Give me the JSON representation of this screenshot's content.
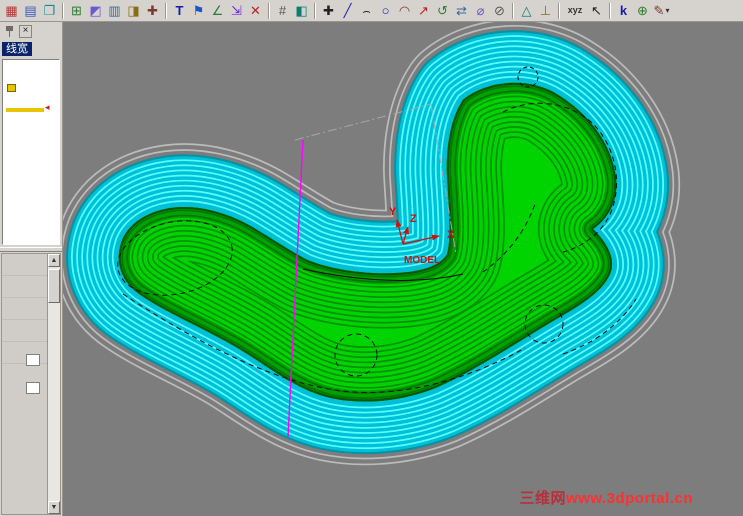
{
  "window": {
    "toolbar_bg": "#d6d3ce",
    "viewport_bg": "#7d7d7d"
  },
  "toolbar": {
    "flyout_arrow": "▾",
    "icons": [
      {
        "name": "sheet-grid-icon",
        "glyph": "▦",
        "color": "#b23333"
      },
      {
        "name": "workbook-icon",
        "glyph": "▤",
        "color": "#3355bb"
      },
      {
        "name": "cascade-windows-icon",
        "glyph": "❐",
        "color": "#118a9e"
      },
      {
        "type": "sep"
      },
      {
        "name": "grid-view-icon",
        "glyph": "⊞",
        "color": "#2e7d32"
      },
      {
        "name": "shaded-view-icon",
        "glyph": "◩",
        "color": "#6a5acd"
      },
      {
        "name": "wireframe-view-icon",
        "glyph": "▥",
        "color": "#34699a"
      },
      {
        "name": "half-shade-icon",
        "glyph": "◨",
        "color": "#8a6d1a"
      },
      {
        "name": "pan-icon",
        "glyph": "✚",
        "color": "#7a3b2e"
      },
      {
        "type": "sep"
      },
      {
        "name": "text-tool-icon",
        "glyph": "T",
        "color": "#1a1aa6",
        "bold": true
      },
      {
        "name": "flag-icon",
        "glyph": "⚑",
        "color": "#1a56c4"
      },
      {
        "name": "angle-measure-icon",
        "glyph": "∠",
        "color": "#2e7d32"
      },
      {
        "name": "fit-extents-icon",
        "glyph": "⇲",
        "color": "#6a2bd2"
      },
      {
        "name": "delete-icon",
        "glyph": "✕",
        "color": "#b22222"
      },
      {
        "type": "sep"
      },
      {
        "name": "grid-snap-icon",
        "glyph": "#",
        "color": "#555555"
      },
      {
        "name": "section-view-icon",
        "glyph": "◧",
        "color": "#0b7d6e"
      },
      {
        "type": "sep"
      },
      {
        "name": "point-tool-icon",
        "glyph": "✚",
        "color": "#222222"
      },
      {
        "name": "line-tool-icon",
        "glyph": "╱",
        "color": "#1a1aa6"
      },
      {
        "name": "arc-tool-icon",
        "glyph": "⌢",
        "color": "#222222"
      },
      {
        "name": "circle-tool-icon",
        "glyph": "○",
        "color": "#1a1aa6"
      },
      {
        "name": "half-arc-tool-icon",
        "glyph": "◠",
        "color": "#7a3b2e"
      },
      {
        "name": "vector-tool-icon",
        "glyph": "↗",
        "color": "#b22222"
      },
      {
        "name": "rotate-tool-icon",
        "glyph": "↺",
        "color": "#2e7d32"
      },
      {
        "name": "mirror-tool-icon",
        "glyph": "⇄",
        "color": "#34699a"
      },
      {
        "name": "diameter-tool-icon",
        "glyph": "⌀",
        "color": "#6a5acd"
      },
      {
        "name": "trim-tool-icon",
        "glyph": "⊘",
        "color": "#555555"
      },
      {
        "type": "sep"
      },
      {
        "name": "triangle-snap-icon",
        "glyph": "△",
        "color": "#0b7d6e"
      },
      {
        "name": "perpendicular-icon",
        "glyph": "⊥",
        "color": "#8a6d1a"
      },
      {
        "type": "sep"
      },
      {
        "name": "xyz-readout-icon",
        "glyph": "xyz",
        "color": "#333333",
        "small": true
      },
      {
        "name": "select-arrow-icon",
        "glyph": "↖",
        "color": "#222222"
      },
      {
        "type": "sep"
      },
      {
        "name": "k-style-icon",
        "glyph": "k",
        "color": "#1a1aa6",
        "bold": true
      },
      {
        "name": "zoom-in-icon",
        "glyph": "⊕",
        "color": "#2e7d32"
      },
      {
        "name": "pen-flyout-icon",
        "glyph": "✎",
        "color": "#7a3b2e",
        "dropdown": true
      }
    ]
  },
  "sidebar": {
    "selected_item": "线宽",
    "close_label": "×",
    "scroll_up": "▲",
    "scroll_down": "▼"
  },
  "viewport": {
    "axis": {
      "x": "X",
      "y": "Y",
      "z": "Z",
      "model": "MODEL",
      "color": "#cc1111"
    },
    "watermark": {
      "site": "三维网",
      "url": "www.3dportal.cn",
      "site_color": "#b5303a",
      "url_color": "#ff2f2f"
    },
    "colors": {
      "bg": "#7d7d7d",
      "gray_line": "#bcbcbc",
      "cyan_base": "#00c0d8",
      "cyan_line": "#55ffff",
      "cyan_edge": "#0892a2",
      "green_base": "#00d400",
      "green_line": "#079107",
      "green_edge": "#045804",
      "feature": "#0a0a0a",
      "magenta": "#ff00ff",
      "construction": "#a8a8a8"
    }
  }
}
